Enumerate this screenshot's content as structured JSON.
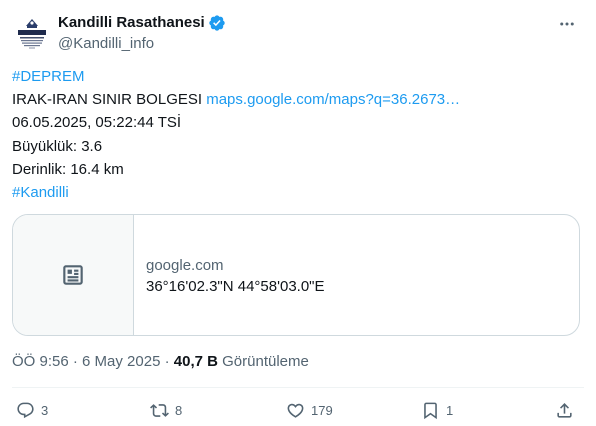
{
  "author": {
    "name": "Kandilli Rasathanesi",
    "handle": "@Kandilli_info",
    "avatar_logo_text": "KANDILLI"
  },
  "tweet": {
    "lines": [
      {
        "hashtag": "#DEPREM"
      },
      {
        "text": "IRAK-IRAN SINIR BOLGESI ",
        "link": "maps.google.com/maps?q=36.2673…"
      },
      {
        "text": "06.05.2025, 05:22:44 TSİ"
      },
      {
        "text": "Büyüklük: 3.6"
      },
      {
        "text": "Derinlik: 16.4 km"
      },
      {
        "hashtag": "#Kandilli"
      }
    ]
  },
  "card": {
    "icon": "article-icon",
    "domain": "google.com",
    "title": "36°16'02.3\"N 44°58'03.0\"E"
  },
  "meta": {
    "time": "ÖÖ 9:56 · 6 May 2025",
    "separator": " · ",
    "views_count": "40,7 B",
    "views_label": " Görüntüleme"
  },
  "actions": {
    "reply_count": "3",
    "retweet_count": "8",
    "like_count": "179",
    "bookmark_count": "1"
  },
  "colors": {
    "accent": "#1d9bf0",
    "text": "#0f1419",
    "secondary": "#536471",
    "border": "#cfd9de"
  }
}
